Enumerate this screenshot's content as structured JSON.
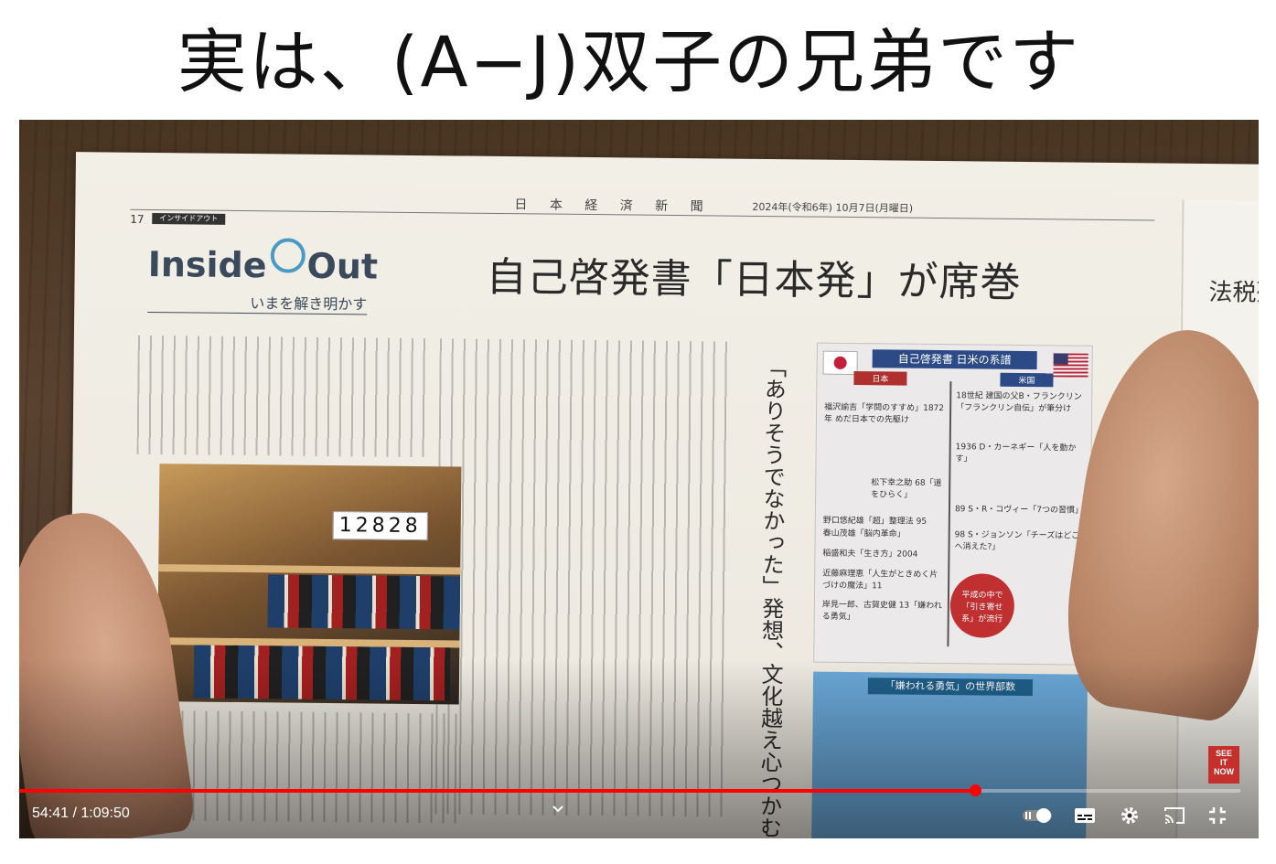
{
  "page_heading": "実は、(A−J)双子の兄弟です",
  "newspaper": {
    "page_number": "17",
    "section_tag": "インサイドアウト",
    "masthead": "日 本 経 済 新 聞",
    "date": "2024年(令和6年) 10月7日(月曜日)",
    "logo_left": "Inside",
    "logo_right": "Out",
    "logo_tagline": "いまを解き明かす",
    "headline": "自己啓発書「日本発」が席巻",
    "vertical_heading": "「ありそうでなかった」発想、文化越え心つかむ",
    "photo_counter": "12828",
    "next_page_heading": "法税残",
    "infographic": {
      "title": "自己啓発書 日米の系譜",
      "col_japan": "日本",
      "col_us": "米国",
      "rows": [
        "18世紀 建国の父B・フランクリン「フランクリン自伝」が筆分け",
        "福沢諭吉「学問のすすめ」1872年 めだ日本での先駆け",
        "1936 D・カーネギー「人を動かす」",
        "松下幸之助 68「道をひらく」",
        "89 S・R・コヴィー「7つの習慣」",
        "98 S・ジョンソン「チーズはどこへ消えた?」",
        "野口悠紀雄「超」整理法 95",
        "春山茂雄「脳内革命」",
        "稲盛和夫「生き方」2004",
        "近藤麻理恵「人生がときめく片づけの魔法」11",
        "岸見一郎、古賀史健 13「嫌われる勇気」"
      ],
      "badge": "平成の中で「引き寄せ系」が流行"
    },
    "map_title": "「嫌われる勇気」の世界部数"
  },
  "player": {
    "current_time": "54:41",
    "separator": " / ",
    "duration": "1:09:50",
    "progress_fraction": 0.783,
    "buffer_fraction": 0.77,
    "badge_lines": [
      "SEE",
      "IT",
      "NOW"
    ],
    "accent_color": "#ff0000",
    "controls": [
      "autoplay-toggle-icon",
      "subtitles-icon",
      "settings-gear-icon",
      "cast-icon",
      "exit-fullscreen-icon"
    ]
  }
}
